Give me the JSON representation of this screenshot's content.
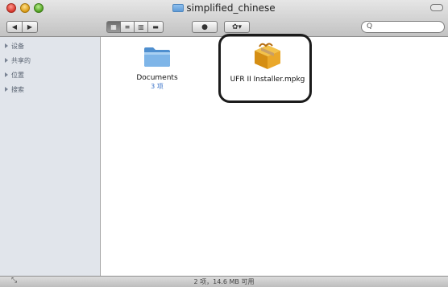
{
  "window": {
    "title": "simplified_chinese"
  },
  "toolbar": {
    "back": "◀",
    "forward": "▶",
    "views": [
      "▦",
      "≡",
      "▥",
      "▬"
    ],
    "quicklook": "●",
    "action": "✿▾",
    "search_placeholder": "Q"
  },
  "sidebar": {
    "items": [
      {
        "label": "设备"
      },
      {
        "label": "共享的"
      },
      {
        "label": "位置"
      },
      {
        "label": "搜索"
      }
    ]
  },
  "content": {
    "items": [
      {
        "label": "Documents",
        "sub": "3 项",
        "icon": "folder-icon"
      },
      {
        "label": "UFR II Installer.mpkg",
        "sub": "",
        "icon": "package-icon"
      }
    ]
  },
  "status": {
    "text": "2 项，14.6 MB 可用"
  },
  "colors": {
    "folder": "#6aa7df",
    "package": "#e2a21a",
    "highlight": "#1b1b1b"
  }
}
